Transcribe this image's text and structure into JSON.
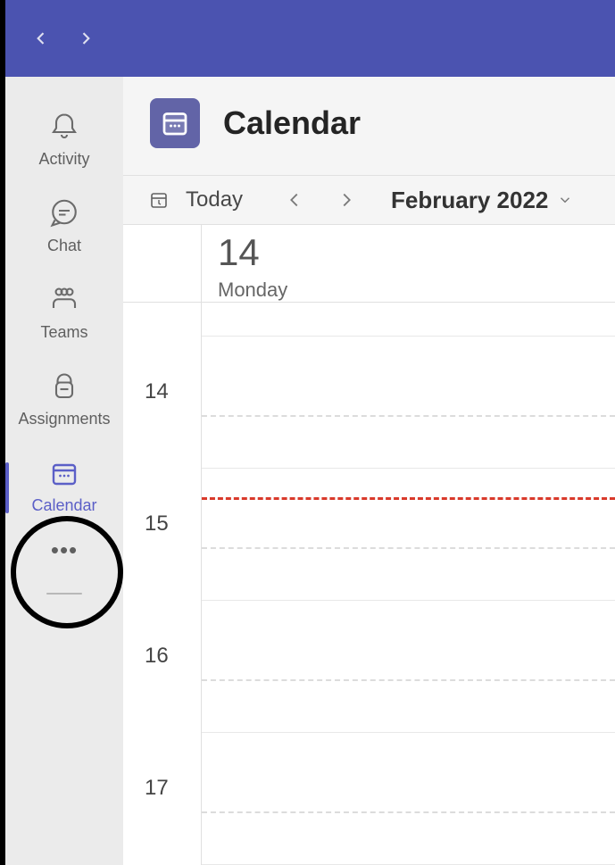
{
  "sidebar": {
    "items": [
      {
        "label": "Activity"
      },
      {
        "label": "Chat"
      },
      {
        "label": "Teams"
      },
      {
        "label": "Assignments"
      },
      {
        "label": "Calendar"
      }
    ]
  },
  "header": {
    "title": "Calendar"
  },
  "toolbar": {
    "today_label": "Today",
    "month_label": "February 2022"
  },
  "calendar": {
    "day_number": "14",
    "day_name": "Monday",
    "hours": [
      "14",
      "15",
      "16",
      "17"
    ]
  }
}
